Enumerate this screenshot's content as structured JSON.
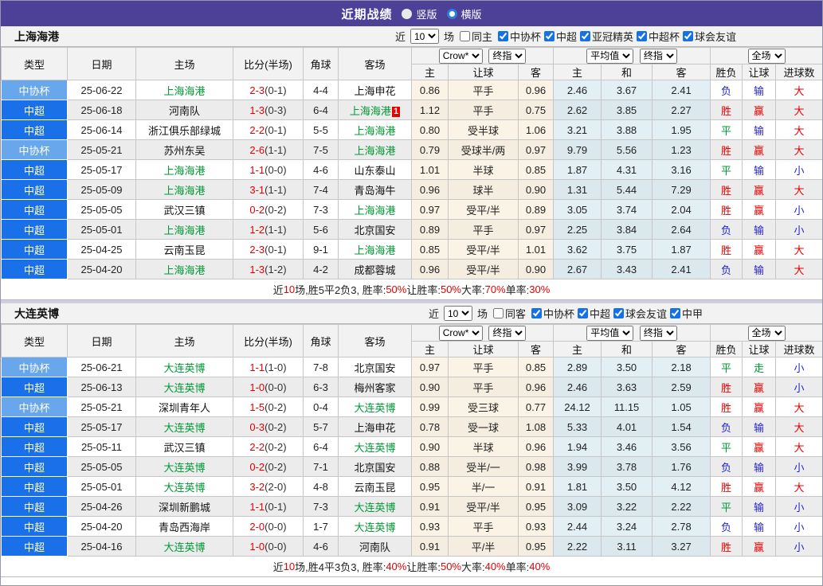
{
  "topbar": {
    "title": "近期战绩",
    "vertical_label": "竖版",
    "horizontal_label": "横版"
  },
  "dropdowns": {
    "bookmaker": "Crow*",
    "final_left": "终指",
    "average": "平均值",
    "final_right": "终指",
    "full_match": "全场"
  },
  "columns": {
    "type": "类型",
    "date": "日期",
    "home": "主场",
    "score": "比分(半场)",
    "corner": "角球",
    "away": "客场",
    "odds_home": "主",
    "odds_handicap": "让球",
    "odds_away": "客",
    "avg_home": "主",
    "avg_draw": "和",
    "avg_away": "客",
    "result_wdl": "胜负",
    "result_handicap": "让球",
    "result_goals": "进球数"
  },
  "filter_words": {
    "prefix": "近",
    "suffix": "场"
  },
  "sections": [
    {
      "team": "上海海港",
      "filter": {
        "count": "10",
        "toggle": "同主",
        "toggle_checked": false,
        "competitions": [
          {
            "label": "中协杯",
            "checked": true
          },
          {
            "label": "中超",
            "checked": true
          },
          {
            "label": "亚冠精英",
            "checked": true
          },
          {
            "label": "中超杯",
            "checked": true
          },
          {
            "label": "球会友谊",
            "checked": true
          }
        ]
      },
      "rows": [
        {
          "comp": "中协杯",
          "date": "25-06-22",
          "home": "上海海港",
          "home_self": true,
          "score": "2-3",
          "half": "(0-1)",
          "corners": "4-4",
          "away": "上海申花",
          "away_self": false,
          "away_card": "",
          "odds": [
            "0.86",
            "平手",
            "0.96"
          ],
          "avg": [
            "2.46",
            "3.67",
            "2.41"
          ],
          "results": [
            "负",
            "输",
            "大"
          ]
        },
        {
          "comp": "中超",
          "date": "25-06-18",
          "home": "河南队",
          "home_self": false,
          "score": "1-3",
          "half": "(0-3)",
          "corners": "6-4",
          "away": "上海海港",
          "away_self": true,
          "away_card": "1",
          "odds": [
            "1.12",
            "平手",
            "0.75"
          ],
          "avg": [
            "2.62",
            "3.85",
            "2.27"
          ],
          "results": [
            "胜",
            "赢",
            "大"
          ]
        },
        {
          "comp": "中超",
          "date": "25-06-14",
          "home": "浙江俱乐部绿城",
          "home_self": false,
          "score": "2-2",
          "half": "(0-1)",
          "corners": "5-5",
          "away": "上海海港",
          "away_self": true,
          "away_card": "",
          "odds": [
            "0.80",
            "受半球",
            "1.06"
          ],
          "avg": [
            "3.21",
            "3.88",
            "1.95"
          ],
          "results": [
            "平",
            "输",
            "大"
          ]
        },
        {
          "comp": "中协杯",
          "date": "25-05-21",
          "home": "苏州东吴",
          "home_self": false,
          "score": "2-6",
          "half": "(1-1)",
          "corners": "7-5",
          "away": "上海海港",
          "away_self": true,
          "away_card": "",
          "odds": [
            "0.79",
            "受球半/两",
            "0.97"
          ],
          "avg": [
            "9.79",
            "5.56",
            "1.23"
          ],
          "results": [
            "胜",
            "赢",
            "大"
          ]
        },
        {
          "comp": "中超",
          "date": "25-05-17",
          "home": "上海海港",
          "home_self": true,
          "score": "1-1",
          "half": "(0-0)",
          "corners": "4-6",
          "away": "山东泰山",
          "away_self": false,
          "away_card": "",
          "odds": [
            "1.01",
            "半球",
            "0.85"
          ],
          "avg": [
            "1.87",
            "4.31",
            "3.16"
          ],
          "results": [
            "平",
            "输",
            "小"
          ]
        },
        {
          "comp": "中超",
          "date": "25-05-09",
          "home": "上海海港",
          "home_self": true,
          "score": "3-1",
          "half": "(1-1)",
          "corners": "7-4",
          "away": "青岛海牛",
          "away_self": false,
          "away_card": "",
          "odds": [
            "0.96",
            "球半",
            "0.90"
          ],
          "avg": [
            "1.31",
            "5.44",
            "7.29"
          ],
          "results": [
            "胜",
            "赢",
            "大"
          ]
        },
        {
          "comp": "中超",
          "date": "25-05-05",
          "home": "武汉三镇",
          "home_self": false,
          "score": "0-2",
          "half": "(0-2)",
          "corners": "7-3",
          "away": "上海海港",
          "away_self": true,
          "away_card": "",
          "odds": [
            "0.97",
            "受平/半",
            "0.89"
          ],
          "avg": [
            "3.05",
            "3.74",
            "2.04"
          ],
          "results": [
            "胜",
            "赢",
            "小"
          ]
        },
        {
          "comp": "中超",
          "date": "25-05-01",
          "home": "上海海港",
          "home_self": true,
          "score": "1-2",
          "half": "(1-1)",
          "corners": "5-6",
          "away": "北京国安",
          "away_self": false,
          "away_card": "",
          "odds": [
            "0.89",
            "平手",
            "0.97"
          ],
          "avg": [
            "2.25",
            "3.84",
            "2.64"
          ],
          "results": [
            "负",
            "输",
            "小"
          ]
        },
        {
          "comp": "中超",
          "date": "25-04-25",
          "home": "云南玉昆",
          "home_self": false,
          "score": "2-3",
          "half": "(0-1)",
          "corners": "9-1",
          "away": "上海海港",
          "away_self": true,
          "away_card": "",
          "odds": [
            "0.85",
            "受平/半",
            "1.01"
          ],
          "avg": [
            "3.62",
            "3.75",
            "1.87"
          ],
          "results": [
            "胜",
            "赢",
            "大"
          ]
        },
        {
          "comp": "中超",
          "date": "25-04-20",
          "home": "上海海港",
          "home_self": true,
          "score": "1-3",
          "half": "(1-2)",
          "corners": "4-2",
          "away": "成都蓉城",
          "away_self": false,
          "away_card": "",
          "odds": [
            "0.96",
            "受平/半",
            "0.90"
          ],
          "avg": [
            "2.67",
            "3.43",
            "2.41"
          ],
          "results": [
            "负",
            "输",
            "大"
          ]
        }
      ],
      "summary": [
        [
          "近",
          0
        ],
        [
          "10",
          1
        ],
        [
          "场,胜5平2负3, 胜率:",
          0
        ],
        [
          "50%",
          1
        ],
        [
          " 让胜率:",
          0
        ],
        [
          "50%",
          1
        ],
        [
          " 大率:",
          0
        ],
        [
          "70%",
          1
        ],
        [
          " 单率:",
          0
        ],
        [
          "30%",
          1
        ]
      ]
    },
    {
      "team": "大连英博",
      "filter": {
        "count": "10",
        "toggle": "同客",
        "toggle_checked": false,
        "competitions": [
          {
            "label": "中协杯",
            "checked": true
          },
          {
            "label": "中超",
            "checked": true
          },
          {
            "label": "球会友谊",
            "checked": true
          },
          {
            "label": "中甲",
            "checked": true
          }
        ]
      },
      "rows": [
        {
          "comp": "中协杯",
          "date": "25-06-21",
          "home": "大连英博",
          "home_self": true,
          "score": "1-1",
          "half": "(1-0)",
          "corners": "7-8",
          "away": "北京国安",
          "away_self": false,
          "away_card": "",
          "odds": [
            "0.97",
            "平手",
            "0.85"
          ],
          "avg": [
            "2.89",
            "3.50",
            "2.18"
          ],
          "results": [
            "平",
            "走",
            "小"
          ]
        },
        {
          "comp": "中超",
          "date": "25-06-13",
          "home": "大连英博",
          "home_self": true,
          "score": "1-0",
          "half": "(0-0)",
          "corners": "6-3",
          "away": "梅州客家",
          "away_self": false,
          "away_card": "",
          "odds": [
            "0.90",
            "平手",
            "0.96"
          ],
          "avg": [
            "2.46",
            "3.63",
            "2.59"
          ],
          "results": [
            "胜",
            "赢",
            "小"
          ]
        },
        {
          "comp": "中协杯",
          "date": "25-05-21",
          "home": "深圳青年人",
          "home_self": false,
          "score": "1-5",
          "half": "(0-2)",
          "corners": "0-4",
          "away": "大连英博",
          "away_self": true,
          "away_card": "",
          "odds": [
            "0.99",
            "受三球",
            "0.77"
          ],
          "avg": [
            "24.12",
            "11.15",
            "1.05"
          ],
          "results": [
            "胜",
            "赢",
            "大"
          ]
        },
        {
          "comp": "中超",
          "date": "25-05-17",
          "home": "大连英博",
          "home_self": true,
          "score": "0-3",
          "half": "(0-2)",
          "corners": "5-7",
          "away": "上海申花",
          "away_self": false,
          "away_card": "",
          "odds": [
            "0.78",
            "受一球",
            "1.08"
          ],
          "avg": [
            "5.33",
            "4.01",
            "1.54"
          ],
          "results": [
            "负",
            "输",
            "大"
          ]
        },
        {
          "comp": "中超",
          "date": "25-05-11",
          "home": "武汉三镇",
          "home_self": false,
          "score": "2-2",
          "half": "(0-2)",
          "corners": "6-4",
          "away": "大连英博",
          "away_self": true,
          "away_card": "",
          "odds": [
            "0.90",
            "半球",
            "0.96"
          ],
          "avg": [
            "1.94",
            "3.46",
            "3.56"
          ],
          "results": [
            "平",
            "赢",
            "大"
          ]
        },
        {
          "comp": "中超",
          "date": "25-05-05",
          "home": "大连英博",
          "home_self": true,
          "score": "0-2",
          "half": "(0-2)",
          "corners": "7-1",
          "away": "北京国安",
          "away_self": false,
          "away_card": "",
          "odds": [
            "0.88",
            "受半/一",
            "0.98"
          ],
          "avg": [
            "3.99",
            "3.78",
            "1.76"
          ],
          "results": [
            "负",
            "输",
            "小"
          ]
        },
        {
          "comp": "中超",
          "date": "25-05-01",
          "home": "大连英博",
          "home_self": true,
          "score": "3-2",
          "half": "(2-0)",
          "corners": "4-8",
          "away": "云南玉昆",
          "away_self": false,
          "away_card": "",
          "odds": [
            "0.95",
            "半/一",
            "0.91"
          ],
          "avg": [
            "1.81",
            "3.50",
            "4.12"
          ],
          "results": [
            "胜",
            "赢",
            "大"
          ]
        },
        {
          "comp": "中超",
          "date": "25-04-26",
          "home": "深圳新鹏城",
          "home_self": false,
          "score": "1-1",
          "half": "(0-1)",
          "corners": "7-3",
          "away": "大连英博",
          "away_self": true,
          "away_card": "",
          "odds": [
            "0.91",
            "受平/半",
            "0.95"
          ],
          "avg": [
            "3.09",
            "3.22",
            "2.22"
          ],
          "results": [
            "平",
            "输",
            "小"
          ]
        },
        {
          "comp": "中超",
          "date": "25-04-20",
          "home": "青岛西海岸",
          "home_self": false,
          "score": "2-0",
          "half": "(0-0)",
          "corners": "1-7",
          "away": "大连英博",
          "away_self": true,
          "away_card": "",
          "odds": [
            "0.93",
            "平手",
            "0.93"
          ],
          "avg": [
            "2.44",
            "3.24",
            "2.78"
          ],
          "results": [
            "负",
            "输",
            "小"
          ]
        },
        {
          "comp": "中超",
          "date": "25-04-16",
          "home": "大连英博",
          "home_self": true,
          "score": "1-0",
          "half": "(0-0)",
          "corners": "4-6",
          "away": "河南队",
          "away_self": false,
          "away_card": "",
          "odds": [
            "0.91",
            "平/半",
            "0.95"
          ],
          "avg": [
            "2.22",
            "3.11",
            "3.27"
          ],
          "results": [
            "胜",
            "赢",
            "小"
          ]
        }
      ],
      "summary": [
        [
          "近",
          0
        ],
        [
          "10",
          1
        ],
        [
          "场,胜4平3负3, 胜率:",
          0
        ],
        [
          "40%",
          1
        ],
        [
          " 让胜率:",
          0
        ],
        [
          "50%",
          1
        ],
        [
          " 大率:",
          0
        ],
        [
          "40%",
          1
        ],
        [
          " 单率:",
          0
        ],
        [
          "40%",
          1
        ]
      ]
    }
  ]
}
